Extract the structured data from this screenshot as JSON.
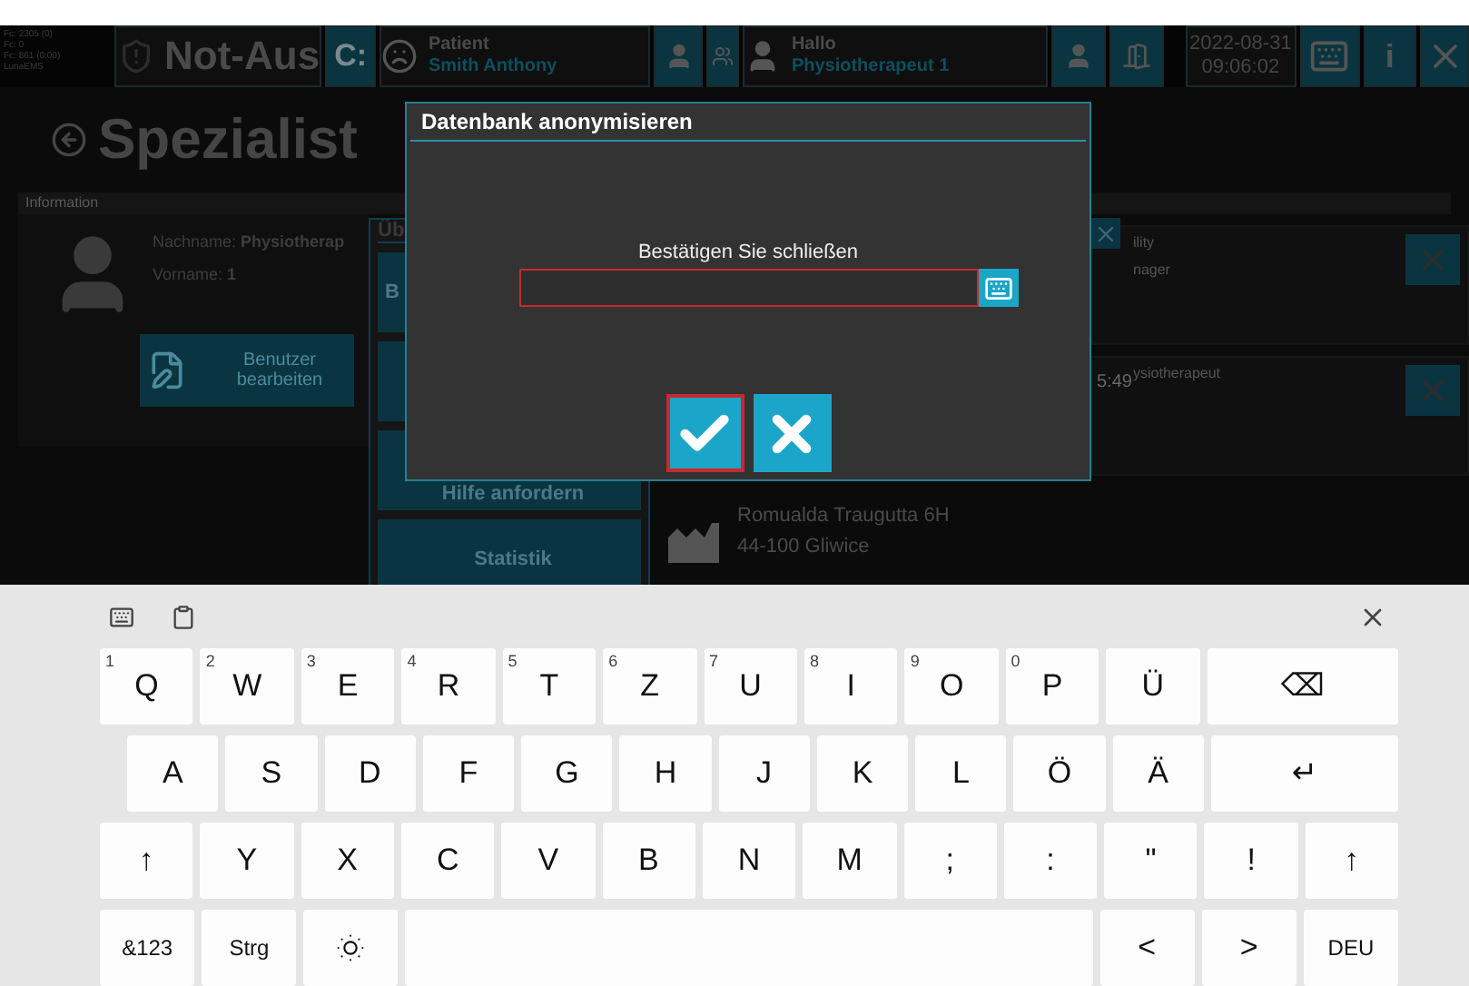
{
  "status_lines": [
    "Fc: 2305 (0)",
    "Fc: 0",
    "Fc: 861 (0:00)",
    "LunaEMS"
  ],
  "header": {
    "emergency_stop": "Not-Aus",
    "c_button": "C:",
    "patient_label": "Patient",
    "patient_name": "Smith Anthony",
    "user_greeting": "Hallo",
    "user_name": "Physiotherapeut 1",
    "date": "2022-08-31",
    "time": "09:06:02",
    "info_button": "i"
  },
  "page_title": "Spezialist",
  "info_bar": "Information",
  "profile": {
    "fields": [
      {
        "label": "Nachname:",
        "value": "Physiotherap"
      },
      {
        "label": "Vorname:",
        "value": "1"
      }
    ],
    "edit_button": "Benutzer bearbeiten"
  },
  "side_dialog": {
    "title": "Üb",
    "buttons": [
      {
        "kind": "text",
        "label": "B"
      },
      {
        "kind": "blank"
      },
      {
        "kind": "text",
        "label": "Hilfe anfordern"
      },
      {
        "kind": "text",
        "label": "Statistik"
      }
    ]
  },
  "address": [
    "Romualda Traugutta 6H",
    "44-100 Gliwice"
  ],
  "right_list": [
    {
      "lines": [
        "ility",
        "nager"
      ]
    },
    {
      "time": "5:49",
      "lines": [
        "ysiotherapeut"
      ]
    }
  ],
  "dialog": {
    "title": "Datenbank anonymisieren",
    "prompt": "Bestätigen Sie schließen",
    "input": {
      "invalid": true
    },
    "confirm": {
      "focused": true
    }
  },
  "keyboard": {
    "rows": [
      [
        {
          "kind": "char",
          "label": "Q",
          "hint": "1"
        },
        {
          "kind": "char",
          "label": "W",
          "hint": "2"
        },
        {
          "kind": "char",
          "label": "E",
          "hint": "3"
        },
        {
          "kind": "char",
          "label": "R",
          "hint": "4"
        },
        {
          "kind": "char",
          "label": "T",
          "hint": "5"
        },
        {
          "kind": "char",
          "label": "Z",
          "hint": "6"
        },
        {
          "kind": "char",
          "label": "U",
          "hint": "7"
        },
        {
          "kind": "char",
          "label": "I",
          "hint": "8"
        },
        {
          "kind": "char",
          "label": "O",
          "hint": "9"
        },
        {
          "kind": "char",
          "label": "P",
          "hint": "0"
        },
        {
          "kind": "char",
          "label": "Ü"
        },
        {
          "kind": "wide",
          "label": "⌫"
        }
      ],
      [
        {
          "kind": "char",
          "label": "A"
        },
        {
          "kind": "char",
          "label": "S"
        },
        {
          "kind": "char",
          "label": "D"
        },
        {
          "kind": "char",
          "label": "F"
        },
        {
          "kind": "char",
          "label": "G"
        },
        {
          "kind": "char",
          "label": "H"
        },
        {
          "kind": "char",
          "label": "J"
        },
        {
          "kind": "char",
          "label": "K"
        },
        {
          "kind": "char",
          "label": "L"
        },
        {
          "kind": "char",
          "label": "Ö"
        },
        {
          "kind": "char",
          "label": "Ä"
        },
        {
          "kind": "wide",
          "label": "↵"
        }
      ],
      [
        {
          "kind": "char",
          "label": "↑"
        },
        {
          "kind": "char",
          "label": "Y"
        },
        {
          "kind": "char",
          "label": "X"
        },
        {
          "kind": "char",
          "label": "C"
        },
        {
          "kind": "char",
          "label": "V"
        },
        {
          "kind": "char",
          "label": "B"
        },
        {
          "kind": "char",
          "label": "N"
        },
        {
          "kind": "char",
          "label": "M"
        },
        {
          "kind": "char",
          "label": ";"
        },
        {
          "kind": "char",
          "label": ":"
        },
        {
          "kind": "char",
          "label": "\""
        },
        {
          "kind": "char",
          "label": "!"
        },
        {
          "kind": "char",
          "label": "↑"
        }
      ]
    ],
    "bottom_row": [
      {
        "kind": "small",
        "label": "&123"
      },
      {
        "kind": "small",
        "label": "Strg"
      },
      {
        "kind": "sun"
      },
      {
        "kind": "space"
      },
      {
        "kind": "char",
        "label": "<"
      },
      {
        "kind": "char",
        "label": ">"
      },
      {
        "kind": "small",
        "label": "DEU"
      }
    ]
  }
}
